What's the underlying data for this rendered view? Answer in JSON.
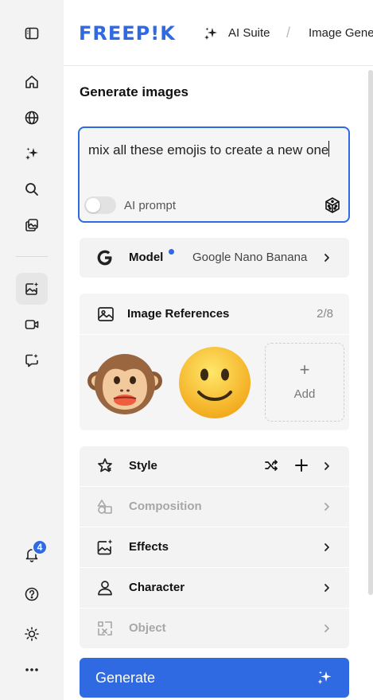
{
  "header": {
    "logo_text": "FREEP!K",
    "suite_label": "AI Suite",
    "breadcrumb_separator": "/",
    "current_page": "Image Gene"
  },
  "sidebar": {
    "items": [
      {
        "icon": "sidebar-toggle-icon"
      },
      {
        "icon": "home-icon"
      },
      {
        "icon": "globe-icon"
      },
      {
        "icon": "sparkles-icon"
      },
      {
        "icon": "search-icon"
      },
      {
        "icon": "library-icon"
      },
      {
        "icon": "image-generator-icon",
        "active": true
      },
      {
        "icon": "video-icon"
      },
      {
        "icon": "assistant-icon"
      }
    ],
    "bottom": [
      {
        "icon": "bell-icon",
        "badge": "4"
      },
      {
        "icon": "help-icon"
      },
      {
        "icon": "sun-icon"
      },
      {
        "icon": "more-icon"
      }
    ]
  },
  "panel": {
    "title": "Generate images",
    "prompt": {
      "value": "mix all these emojis to create a new one",
      "ai_prompt_label": "AI prompt",
      "ai_prompt_enabled": false
    },
    "model": {
      "label": "Model",
      "value": "Google Nano Banana"
    },
    "image_references": {
      "title": "Image References",
      "count": "2/8",
      "items": [
        {
          "emoji": "monkey-face"
        },
        {
          "emoji": "slightly-smiling-face"
        }
      ],
      "add_plus": "+",
      "add_label": "Add"
    },
    "options": [
      {
        "label": "Style",
        "enabled": true
      },
      {
        "label": "Composition",
        "enabled": false
      },
      {
        "label": "Effects",
        "enabled": true
      },
      {
        "label": "Character",
        "enabled": true
      },
      {
        "label": "Object",
        "enabled": false
      }
    ],
    "generate_label": "Generate"
  },
  "colors": {
    "accent": "#2f6ae3",
    "rail_bg": "#f3f3f3",
    "row_bg": "#f3f3f3",
    "disabled_text": "#a7a7a7"
  }
}
